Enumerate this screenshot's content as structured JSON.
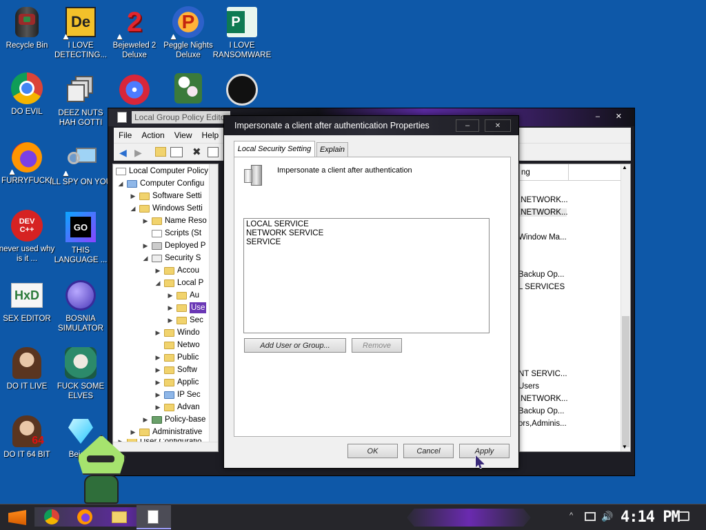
{
  "desktop": {
    "icons": [
      {
        "label": "Recycle Bin"
      },
      {
        "label": "I LOVE DETECTING..."
      },
      {
        "label": "Bejeweled 2 Deluxe"
      },
      {
        "label": "Peggle Nights Deluxe"
      },
      {
        "label": "I LOVE RANSOMWARE"
      },
      {
        "label": "DO EVIL"
      },
      {
        "label": "DEEZ NUTS HAH GOTTI"
      },
      {
        "label": "FURRYFUCK!"
      },
      {
        "label": "ILL SPY ON YOU"
      },
      {
        "label": "never used why is it ..."
      },
      {
        "label": "THIS LANGUAGE ..."
      },
      {
        "label": "SEX EDITOR"
      },
      {
        "label": "BOSNIA SIMULATOR"
      },
      {
        "label": "DO IT LIVE"
      },
      {
        "label": "FUCK SOME ELVES"
      },
      {
        "label": "DO IT 64 BIT"
      },
      {
        "label": "Beje D"
      }
    ],
    "icon_text": {
      "de": "De",
      "bejeweled": "2",
      "peggle": "P",
      "publisher": "P",
      "dev": "DEV C++",
      "go": "GO",
      "hxd": "HxD",
      "sixtyfour": "64"
    }
  },
  "gpedit": {
    "title": "Local Group Policy Editor",
    "menu": [
      "File",
      "Action",
      "View",
      "Help"
    ],
    "tree": [
      {
        "label": "Local Computer Policy"
      },
      {
        "label": "Computer Configu"
      },
      {
        "label": "Software Setti"
      },
      {
        "label": "Windows Setti"
      },
      {
        "label": "Name Reso"
      },
      {
        "label": "Scripts (St"
      },
      {
        "label": "Deployed P"
      },
      {
        "label": "Security S"
      },
      {
        "label": "Accou"
      },
      {
        "label": "Local P"
      },
      {
        "label": "Au"
      },
      {
        "label": "Use"
      },
      {
        "label": "Sec"
      },
      {
        "label": "Windo"
      },
      {
        "label": "Netwo"
      },
      {
        "label": "Public"
      },
      {
        "label": "Softw"
      },
      {
        "label": "Applic"
      },
      {
        "label": "IP Sec"
      },
      {
        "label": "Advan"
      },
      {
        "label": "Policy-base"
      },
      {
        "label": "Administrative"
      },
      {
        "label": "User Configuratio"
      }
    ],
    "right_header": "ng",
    "right_items": [
      ",NETWORK...",
      ",NETWORK...",
      "Window Ma...",
      "Backup Op...",
      "L SERVICES",
      "NT SERVIC...",
      "Users",
      ",NETWORK...",
      "Backup Op...",
      "ors,Adminis..."
    ]
  },
  "dialog": {
    "title": "Impersonate a client after authentication Properties",
    "tabs": [
      "Local Security Setting",
      "Explain"
    ],
    "policy_name": "Impersonate a client after authentication",
    "accounts": [
      "LOCAL SERVICE",
      "NETWORK SERVICE",
      "SERVICE"
    ],
    "add_button": "Add User or Group...",
    "remove_button": "Remove",
    "ok": "OK",
    "cancel": "Cancel",
    "apply": "Apply",
    "minimize_glyph": "–",
    "close_glyph": "✕"
  },
  "taskbar": {
    "clock": "4:14 PM"
  }
}
